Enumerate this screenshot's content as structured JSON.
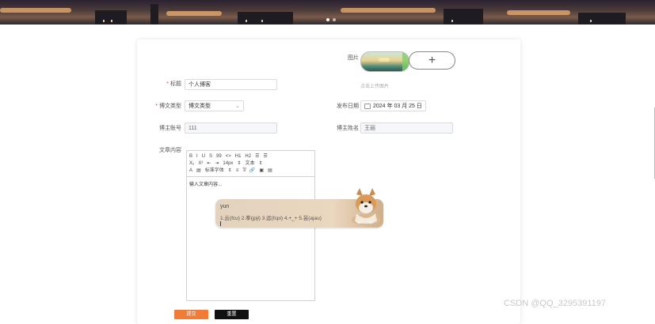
{
  "form": {
    "image_label": "图片",
    "image_hint": "点击上传图片",
    "title_label": "标题",
    "title_value": "个人博客",
    "type_label": "博文类型",
    "type_value": "博文类型",
    "date_label": "发布日期",
    "date_value": "2024 年 03 月 25 日",
    "account_label": "博主账号",
    "account_value": "111",
    "name_label": "博主姓名",
    "name_value": "王丽",
    "content_label": "文章内容"
  },
  "editor": {
    "toolbar_rows": [
      [
        "B",
        "I",
        "U",
        "S",
        "99",
        "<>",
        "H1",
        "H2",
        "☰",
        "☰"
      ],
      [
        "X₂",
        "X²",
        "⇤",
        "⇥",
        "14px",
        "⇕",
        "文本",
        "⇕"
      ],
      [
        "A",
        "▤",
        "标准字体",
        "⇕",
        "≡",
        "T̸",
        "🔗",
        "▣",
        "▤"
      ]
    ],
    "placeholder": "输入文章内容..."
  },
  "tooltip": {
    "title": "yun",
    "body": "1.云(fcu)  2.拳(jpjl)  3.运(fcpi)  4.+_+  5.芸(ajau)"
  },
  "buttons": {
    "submit": "提交",
    "reset": "重置"
  },
  "watermark": "CSDN @QQ_3295391197"
}
